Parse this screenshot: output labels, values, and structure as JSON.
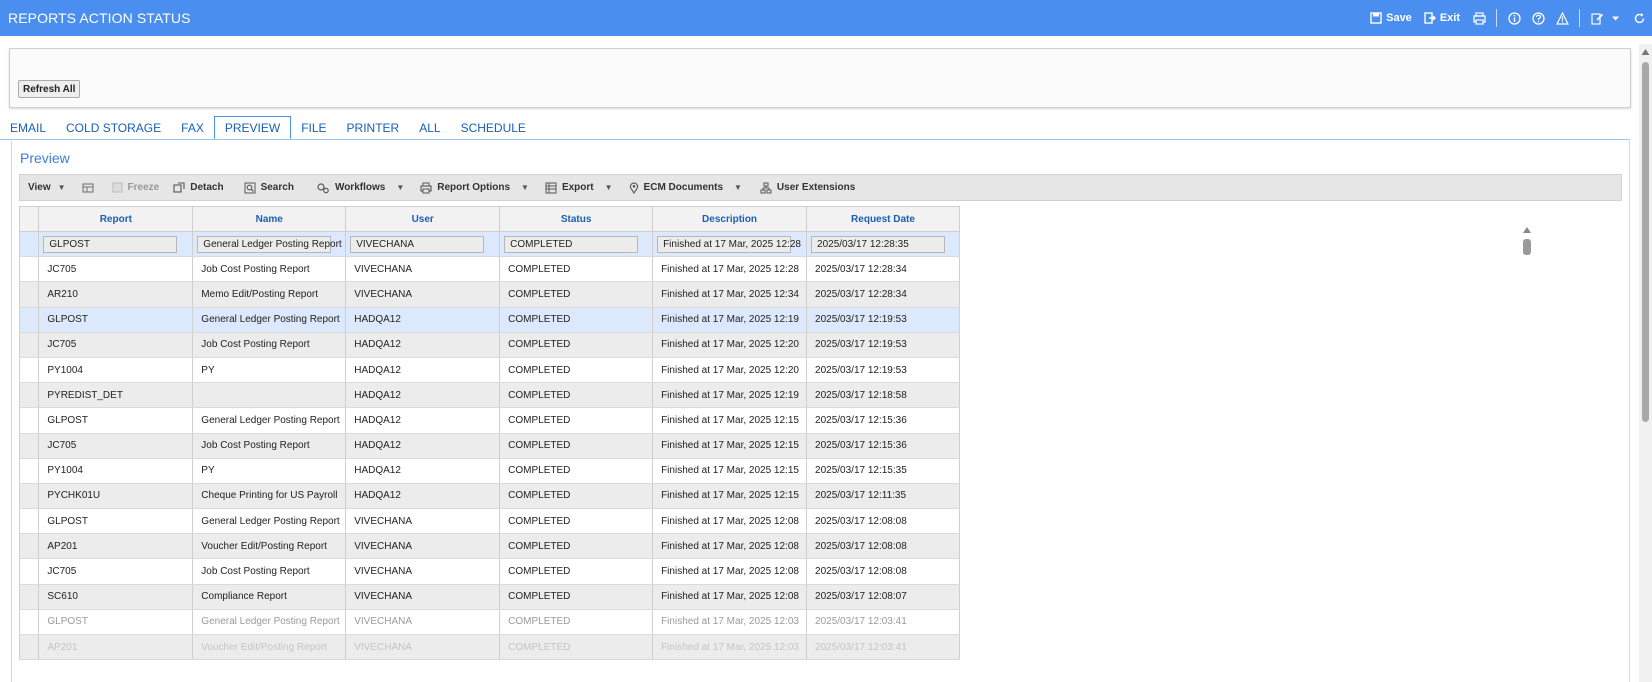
{
  "titlebar": {
    "title": "REPORTS ACTION STATUS",
    "save_label": "Save",
    "exit_label": "Exit"
  },
  "top_panel": {
    "refresh_all_label": "Refresh All"
  },
  "tabs": [
    {
      "label": "EMAIL",
      "active": false
    },
    {
      "label": "COLD STORAGE",
      "active": false
    },
    {
      "label": "FAX",
      "active": false
    },
    {
      "label": "PREVIEW",
      "active": true
    },
    {
      "label": "FILE",
      "active": false
    },
    {
      "label": "PRINTER",
      "active": false
    },
    {
      "label": "ALL",
      "active": false
    },
    {
      "label": "SCHEDULE",
      "active": false
    }
  ],
  "preview": {
    "title": "Preview",
    "toolbar": {
      "view": "View",
      "freeze": "Freeze",
      "detach": "Detach",
      "search": "Search",
      "workflows": "Workflows",
      "report_options": "Report Options",
      "export": "Export",
      "ecm_documents": "ECM Documents",
      "user_extensions": "User Extensions"
    },
    "columns": [
      "Report",
      "Name",
      "User",
      "Status",
      "Description",
      "Request Date"
    ],
    "rows": [
      [
        "GLPOST",
        "General Ledger Posting Report",
        "VIVECHANA",
        "COMPLETED",
        "Finished at 17 Mar, 2025 12:28",
        "2025/03/17 12:28:35"
      ],
      [
        "JC705",
        "Job Cost Posting Report",
        "VIVECHANA",
        "COMPLETED",
        "Finished at 17 Mar, 2025 12:28",
        "2025/03/17 12:28:34"
      ],
      [
        "AR210",
        "Memo Edit/Posting Report",
        "VIVECHANA",
        "COMPLETED",
        "Finished at 17 Mar, 2025 12:34",
        "2025/03/17 12:28:34"
      ],
      [
        "GLPOST",
        "General Ledger Posting Report",
        "HADQA12",
        "COMPLETED",
        "Finished at 17 Mar, 2025 12:19",
        "2025/03/17 12:19:53"
      ],
      [
        "JC705",
        "Job Cost Posting Report",
        "HADQA12",
        "COMPLETED",
        "Finished at 17 Mar, 2025 12:20",
        "2025/03/17 12:19:53"
      ],
      [
        "PY1004",
        "PY",
        "HADQA12",
        "COMPLETED",
        "Finished at 17 Mar, 2025 12:20",
        "2025/03/17 12:19:53"
      ],
      [
        "PYREDIST_DET",
        "",
        "HADQA12",
        "COMPLETED",
        "Finished at 17 Mar, 2025 12:19",
        "2025/03/17 12:18:58"
      ],
      [
        "GLPOST",
        "General Ledger Posting Report",
        "HADQA12",
        "COMPLETED",
        "Finished at 17 Mar, 2025 12:15",
        "2025/03/17 12:15:36"
      ],
      [
        "JC705",
        "Job Cost Posting Report",
        "HADQA12",
        "COMPLETED",
        "Finished at 17 Mar, 2025 12:15",
        "2025/03/17 12:15:36"
      ],
      [
        "PY1004",
        "PY",
        "HADQA12",
        "COMPLETED",
        "Finished at 17 Mar, 2025 12:15",
        "2025/03/17 12:15:35"
      ],
      [
        "PYCHK01U",
        "Cheque Printing for US Payroll",
        "HADQA12",
        "COMPLETED",
        "Finished at 17 Mar, 2025 12:15",
        "2025/03/17 12:11:35"
      ],
      [
        "GLPOST",
        "General Ledger Posting Report",
        "VIVECHANA",
        "COMPLETED",
        "Finished at 17 Mar, 2025 12:08",
        "2025/03/17 12:08:08"
      ],
      [
        "AP201",
        "Voucher Edit/Posting Report",
        "VIVECHANA",
        "COMPLETED",
        "Finished at 17 Mar, 2025 12:08",
        "2025/03/17 12:08:08"
      ],
      [
        "JC705",
        "Job Cost Posting Report",
        "VIVECHANA",
        "COMPLETED",
        "Finished at 17 Mar, 2025 12:08",
        "2025/03/17 12:08:08"
      ],
      [
        "SC610",
        "Compliance Report",
        "VIVECHANA",
        "COMPLETED",
        "Finished at 17 Mar, 2025 12:08",
        "2025/03/17 12:08:07"
      ],
      [
        "GLPOST",
        "General Ledger Posting Report",
        "VIVECHANA",
        "COMPLETED",
        "Finished at 17 Mar, 2025 12:03",
        "2025/03/17 12:03:41"
      ],
      [
        "AP201",
        "Voucher Edit/Posting Report",
        "VIVECHANA",
        "COMPLETED",
        "Finished at 17 Mar, 2025 12:03",
        "2025/03/17 12:03:41"
      ]
    ]
  }
}
